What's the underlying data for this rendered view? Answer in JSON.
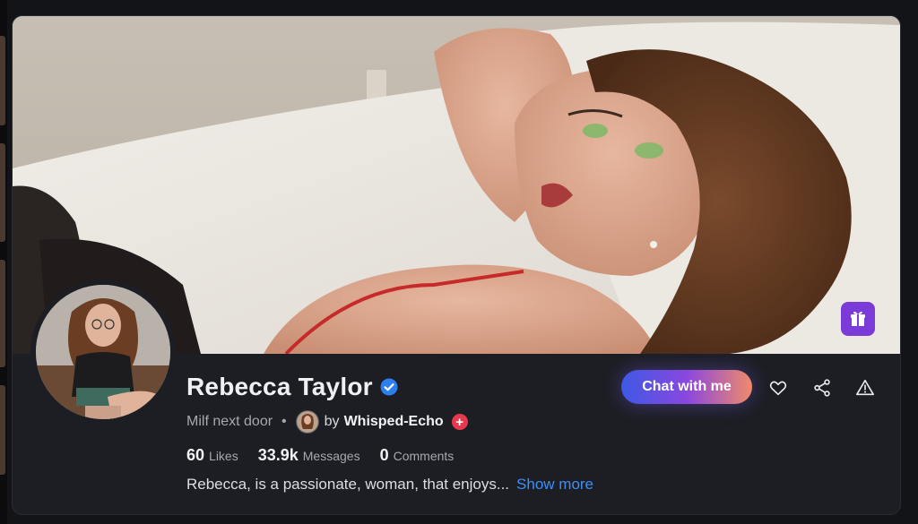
{
  "profile": {
    "name": "Rebecca Taylor",
    "verified": true,
    "tagline": "Milf next door",
    "separator": "•",
    "by_label": "by",
    "creator": "Whisped-Echo",
    "creator_badge": "+"
  },
  "stats": [
    {
      "value": "60",
      "label": "Likes"
    },
    {
      "value": "33.9k",
      "label": "Messages"
    },
    {
      "value": "0",
      "label": "Comments"
    }
  ],
  "description": {
    "text": "Rebecca, is a passionate, woman, that enjoys...",
    "show_more": "Show more"
  },
  "actions": {
    "chat_label": "Chat with me",
    "icons": [
      "heart-icon",
      "share-icon",
      "report-warning-icon",
      "gift-icon"
    ]
  },
  "colors": {
    "accent_purple": "#7b3bd9",
    "link_blue": "#3d8ef5",
    "badge_red": "#e6394f",
    "verified_blue": "#2d7ff0"
  }
}
